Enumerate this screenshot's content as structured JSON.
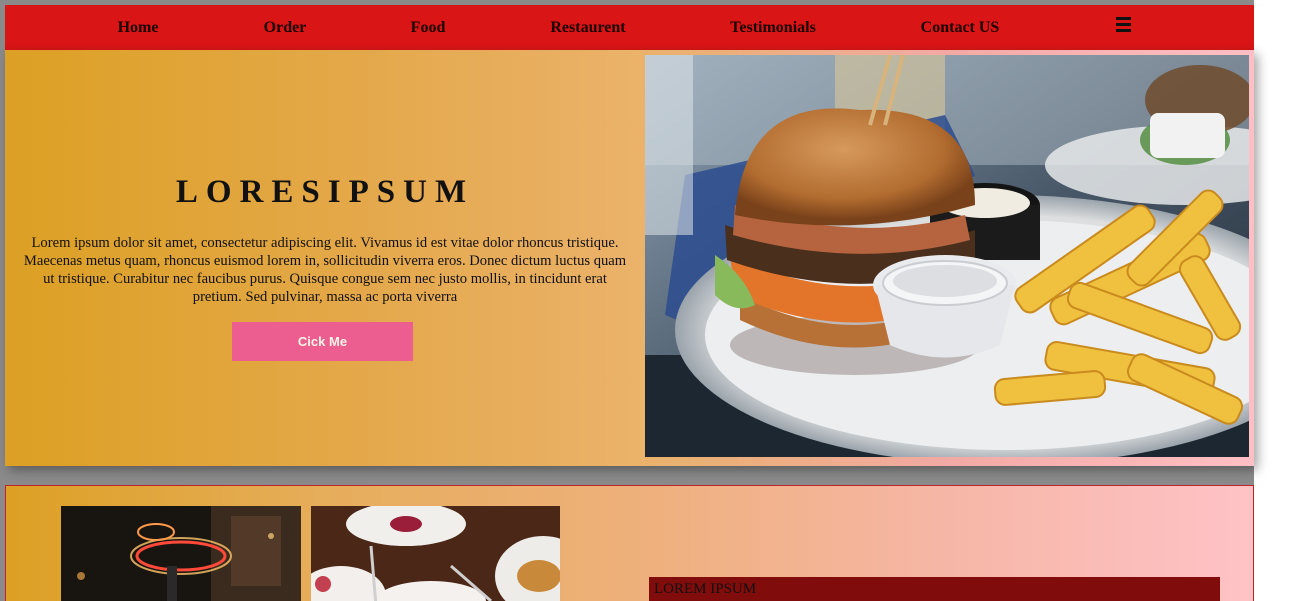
{
  "nav": {
    "items": [
      {
        "label": "Home"
      },
      {
        "label": "Order"
      },
      {
        "label": "Food"
      },
      {
        "label": "Restaurent"
      },
      {
        "label": "Testimonials"
      },
      {
        "label": "Contact US"
      }
    ],
    "menu_icon": "hamburger-menu-icon"
  },
  "hero": {
    "title": "LORESIPSUM",
    "text": "Lorem ipsum dolor sit amet, consectetur adipiscing elit. Vivamus id est vitae dolor rhoncus tristique. Maecenas metus quam, rhoncus euismod lorem in, sollicitudin viverra eros. Donec dictum luctus quam ut tristique. Curabitur nec faucibus purus. Quisque congue sem nec justo mollis, in tincidunt erat pretium. Sed pulvinar, massa ac porta viverra",
    "button_label": "Cick Me",
    "image": "burger-and-fries-photo"
  },
  "gallery": {
    "images": [
      "neon-sign-street-photo",
      "restaurant-dishes-photo"
    ],
    "heading": "LOREM IPSUM"
  },
  "colors": {
    "navbar": "#d91515",
    "button": "#ec5e90",
    "heading_bar": "#810c0c"
  }
}
